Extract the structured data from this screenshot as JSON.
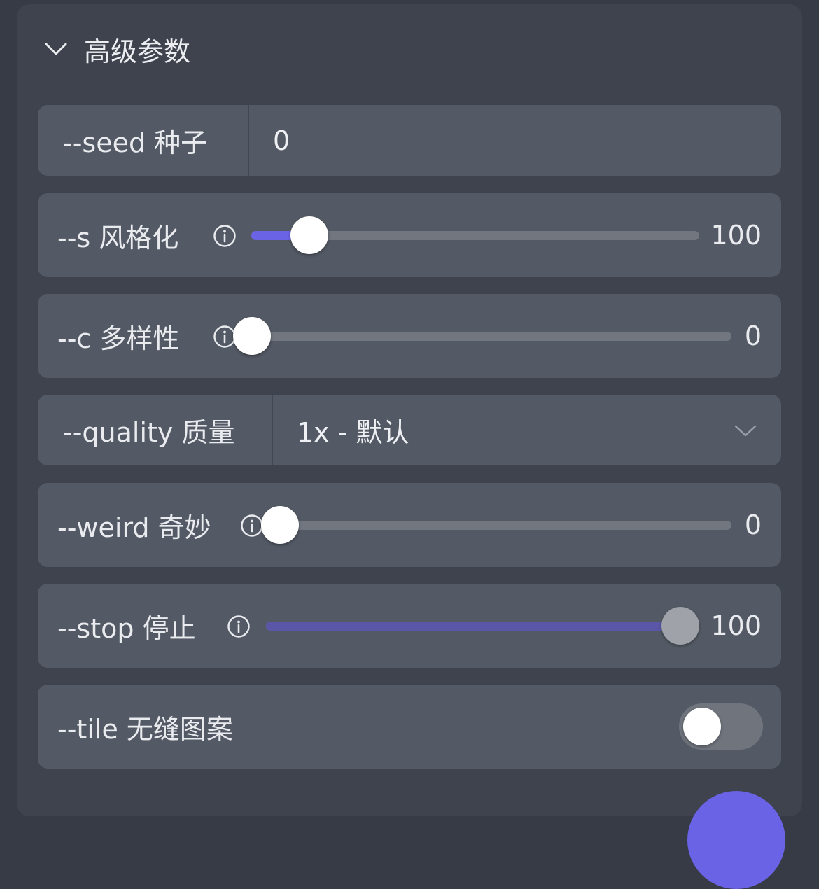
{
  "colors": {
    "accent": "#6b63e6",
    "accent_muted": "#5a57a8",
    "stop_thumb": "#9fa2a8"
  },
  "header": {
    "title": "高级参数",
    "collapse_icon": "chevron-down-icon"
  },
  "seed": {
    "label": "--seed 种子",
    "value": "0"
  },
  "stylize": {
    "label": "--s 风格化",
    "value_text": "100",
    "fill_fraction": 0.13,
    "info_icon": "info-icon"
  },
  "chaos": {
    "label": "--c 多样性",
    "value_text": "0",
    "fill_fraction": 0,
    "info_icon": "info-icon"
  },
  "quality": {
    "label": "--quality 质量",
    "selected": "1x - 默认",
    "dropdown_icon": "chevron-down-icon"
  },
  "weird": {
    "label": "--weird 奇妙",
    "value_text": "0",
    "fill_fraction": 0,
    "info_icon": "info-icon"
  },
  "stop": {
    "label": "--stop 停止",
    "value_text": "100",
    "fill_fraction": 1.0,
    "info_icon": "info-icon"
  },
  "tile": {
    "label": "--tile 无缝图案",
    "enabled": false
  }
}
